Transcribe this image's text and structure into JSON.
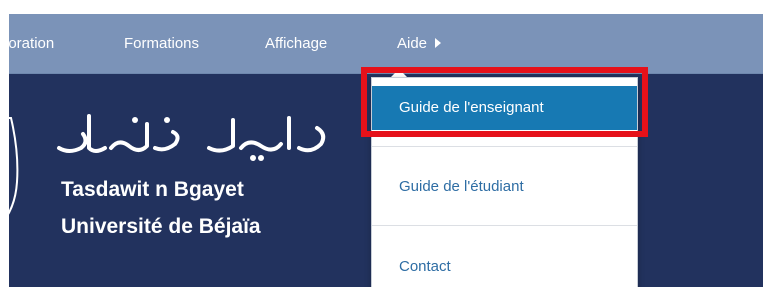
{
  "navbar": {
    "items": [
      {
        "label": "poration"
      },
      {
        "label": "Formations"
      },
      {
        "label": "Affichage"
      },
      {
        "label": "Aide"
      }
    ]
  },
  "banner": {
    "arabic_logo_icon": "arabic-calligraphy-logo",
    "name_line1": "Tasdawit n Bgayet",
    "name_line2": "Université de Béjaïa"
  },
  "aide_menu": {
    "items": [
      {
        "label": "Guide de l'enseignant"
      },
      {
        "label": "Guide de l'étudiant"
      },
      {
        "label": "Contact"
      }
    ]
  },
  "colors": {
    "navbar": "#7b93b8",
    "banner": "#22325e",
    "active_item": "#1779b3",
    "link": "#2e6da4",
    "annotation": "#e6111a"
  }
}
